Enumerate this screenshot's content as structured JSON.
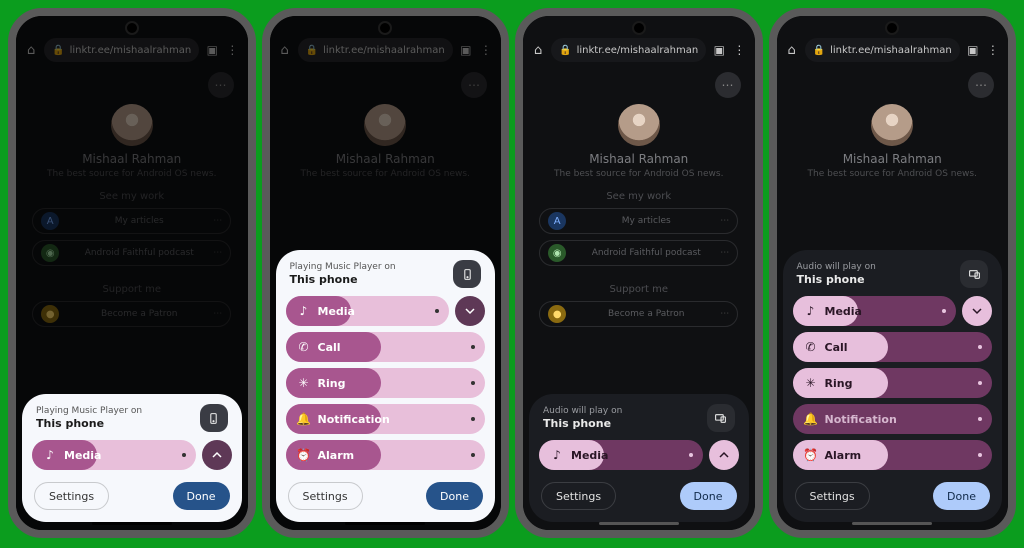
{
  "bg_url": "linktr.ee/mishaalrahman",
  "bg_name": "Mishaal Rahman",
  "bg_tag": "The best source for Android OS news.",
  "bg_sec1": "See my work",
  "bg_link1": "My articles",
  "bg_link2": "Android Faithful podcast",
  "bg_sec2": "Support me",
  "bg_link3": "Become a Patron",
  "panel_light_sub": "Playing Music Player on",
  "panel_dark_sub": "Audio will play on",
  "panel_device": "This phone",
  "sliders": {
    "media": {
      "label": "Media",
      "icon": "♪",
      "fill": 40
    },
    "call": {
      "label": "Call",
      "icon": "✆",
      "fill": 48
    },
    "ring": {
      "label": "Ring",
      "icon": "✳",
      "fill": 48
    },
    "notification": {
      "label": "Notification",
      "icon": "🔔",
      "fill": 48
    },
    "alarm": {
      "label": "Alarm",
      "icon": "⏰",
      "fill": 48
    },
    "notification_off": {
      "label": "Notification",
      "icon": "🔔",
      "fill": 0
    }
  },
  "btn_settings": "Settings",
  "btn_done": "Done"
}
